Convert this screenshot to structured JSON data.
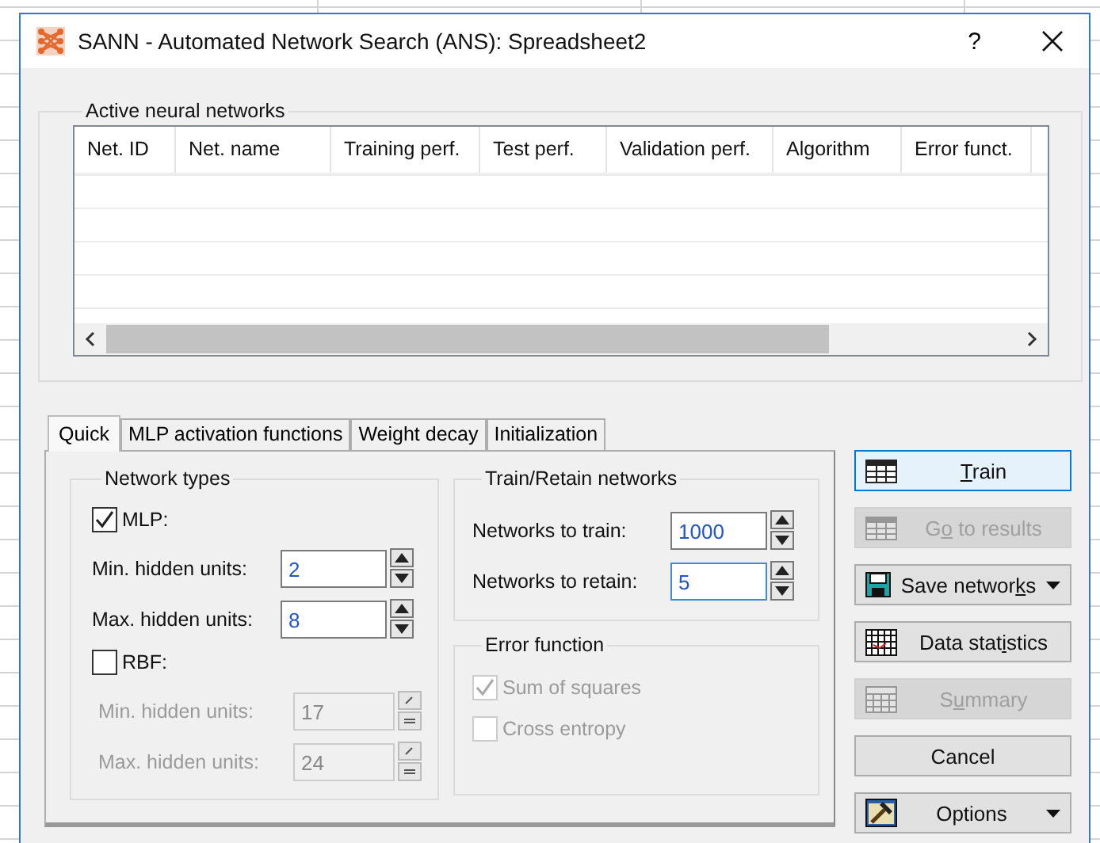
{
  "window": {
    "title": "SANN - Automated Network Search (ANS): Spreadsheet2",
    "help": "?"
  },
  "active_networks": {
    "title": "Active neural networks",
    "columns": [
      "Net. ID",
      "Net. name",
      "Training perf.",
      "Test perf.",
      "Validation perf.",
      "Algorithm",
      "Error funct."
    ]
  },
  "tabs": [
    {
      "label": "Quick",
      "selected": true
    },
    {
      "label": "MLP activation functions",
      "selected": false
    },
    {
      "label": "Weight decay",
      "selected": false
    },
    {
      "label": "Initialization",
      "selected": false
    }
  ],
  "network_types": {
    "title": "Network types",
    "items": [
      {
        "kind": "checkbox",
        "label": "MLP:",
        "checked": true
      },
      {
        "kind": "spinner",
        "label": "Min. hidden units:",
        "value": "2",
        "disabled": false
      },
      {
        "kind": "spinner",
        "label": "Max. hidden units:",
        "value": "8",
        "disabled": false
      },
      {
        "kind": "checkbox",
        "label": "RBF:",
        "checked": false
      },
      {
        "kind": "spinner",
        "label": "Min. hidden units:",
        "value": "17",
        "disabled": true
      },
      {
        "kind": "spinner",
        "label": "Max. hidden units:",
        "value": "24",
        "disabled": true
      }
    ]
  },
  "train_retain": {
    "title": "Train/Retain networks",
    "fields": [
      {
        "label": "Networks to train:",
        "value": "1000",
        "focused": false
      },
      {
        "label": "Networks to retain:",
        "value": "5",
        "focused": true
      }
    ]
  },
  "error_function": {
    "title": "Error function",
    "options": [
      {
        "label": "Sum of squares",
        "checked": true,
        "disabled": true
      },
      {
        "label": "Cross entropy",
        "checked": false,
        "disabled": true
      }
    ]
  },
  "buttons": [
    {
      "kind": "train",
      "label": {
        "underlined": "T",
        "after": "rain"
      },
      "disabled": false,
      "default": true,
      "dropdown": false
    },
    {
      "kind": "results",
      "label": {
        "before": "G",
        "underlined": "o",
        "after": " to results"
      },
      "disabled": true,
      "default": false,
      "dropdown": false
    },
    {
      "kind": "save",
      "label": {
        "before": "Save networ",
        "underlined": "k",
        "after": "s"
      },
      "disabled": false,
      "default": false,
      "dropdown": true
    },
    {
      "kind": "stats",
      "label": {
        "before": "Data stat",
        "underlined": "i",
        "after": "stics"
      },
      "disabled": false,
      "default": false,
      "dropdown": false
    },
    {
      "kind": "summary",
      "label": {
        "before": "S",
        "underlined": "u",
        "after": "mmary"
      },
      "disabled": true,
      "default": false,
      "dropdown": false
    },
    {
      "kind": "plain",
      "label": {
        "before": "Cancel"
      },
      "disabled": false,
      "default": false,
      "dropdown": false
    },
    {
      "kind": "options",
      "label": {
        "before": "Options"
      },
      "disabled": false,
      "default": false,
      "dropdown": true
    }
  ]
}
